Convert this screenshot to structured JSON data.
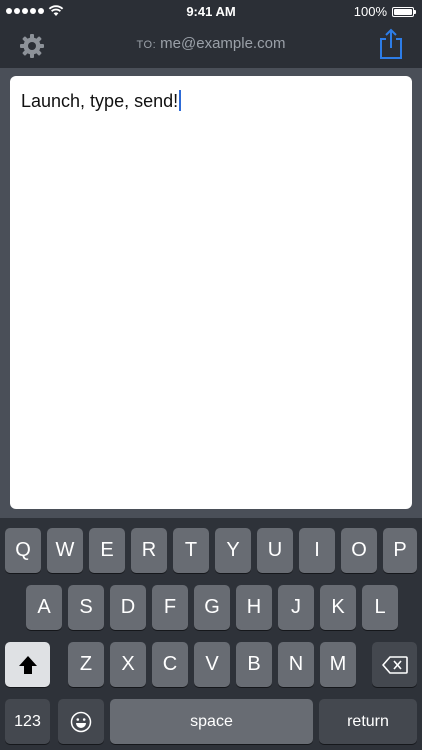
{
  "status": {
    "time": "9:41 AM",
    "battery": "100%"
  },
  "nav": {
    "to_prefix": "TO:",
    "recipient": "me@example.com"
  },
  "editor": {
    "text": "Launch, type, send!"
  },
  "keyboard": {
    "row1": [
      "Q",
      "W",
      "E",
      "R",
      "T",
      "Y",
      "U",
      "I",
      "O",
      "P"
    ],
    "row2": [
      "A",
      "S",
      "D",
      "F",
      "G",
      "H",
      "J",
      "K",
      "L"
    ],
    "row3": [
      "Z",
      "X",
      "C",
      "V",
      "B",
      "N",
      "M"
    ],
    "numbers_label": "123",
    "space_label": "space",
    "return_label": "return"
  },
  "colors": {
    "accent": "#2d6ad6",
    "background": "#2b2f36",
    "key": "#686c73"
  }
}
